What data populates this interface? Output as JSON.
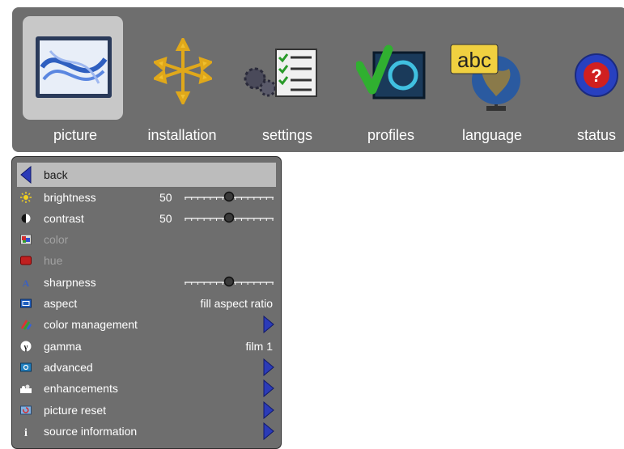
{
  "tabs": [
    {
      "label": "picture",
      "icon": "picture-icon",
      "active": true
    },
    {
      "label": "installation",
      "icon": "installation-icon",
      "active": false
    },
    {
      "label": "settings",
      "icon": "settings-icon",
      "active": false
    },
    {
      "label": "profiles",
      "icon": "profiles-icon",
      "active": false
    },
    {
      "label": "language",
      "icon": "language-icon",
      "active": false
    },
    {
      "label": "status",
      "icon": "status-icon",
      "active": false
    }
  ],
  "language_icon_text": "abc",
  "status_icon_text": "?",
  "menu": {
    "back_label": "back",
    "items": [
      {
        "label": "brightness",
        "icon": "sun-icon",
        "value": "50",
        "slider": 0.5
      },
      {
        "label": "contrast",
        "icon": "contrast-icon",
        "value": "50",
        "slider": 0.5
      },
      {
        "label": "color",
        "icon": "color-icon",
        "disabled": true
      },
      {
        "label": "hue",
        "icon": "hue-icon",
        "disabled": true
      },
      {
        "label": "sharpness",
        "icon": "sharpness-icon",
        "slider": 0.5
      },
      {
        "label": "aspect",
        "icon": "aspect-icon",
        "value": "fill aspect ratio"
      },
      {
        "label": "color management",
        "icon": "color-management-icon",
        "submenu": true
      },
      {
        "label": "gamma",
        "icon": "gamma-icon",
        "value": "film 1"
      },
      {
        "label": "advanced",
        "icon": "advanced-icon",
        "submenu": true
      },
      {
        "label": "enhancements",
        "icon": "enhancements-icon",
        "submenu": true
      },
      {
        "label": "picture reset",
        "icon": "picture-reset-icon",
        "submenu": true
      },
      {
        "label": "source information",
        "icon": "info-icon",
        "submenu": true
      }
    ]
  },
  "colors": {
    "panel_bg": "#6e6e6e",
    "highlight": "#bcbcbc",
    "arrow_blue": "#2b3bb8"
  }
}
